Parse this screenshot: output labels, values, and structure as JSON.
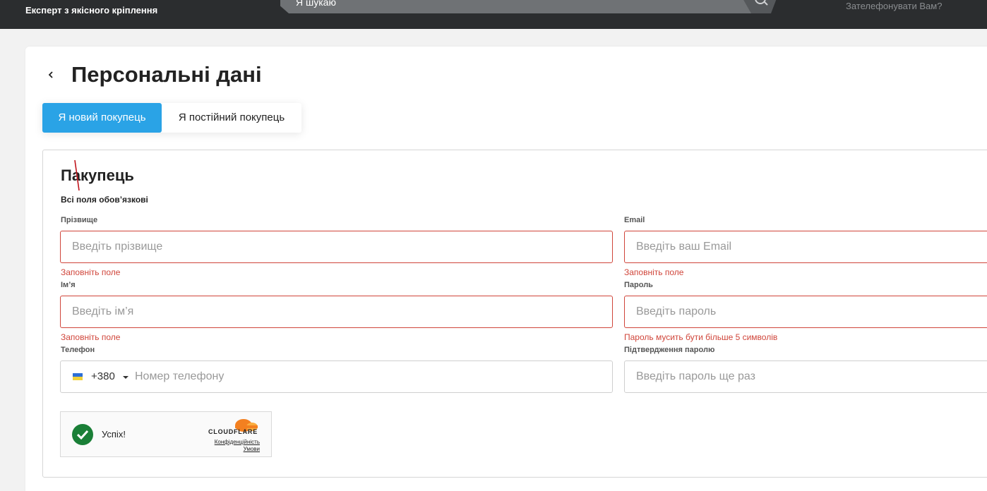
{
  "header": {
    "tagline": "Експерт з якісного кріплення",
    "search_placeholder": "Я шукаю",
    "callback_link": "Зателефонувати Вам?"
  },
  "page": {
    "title": "Персональні дані"
  },
  "tabs": [
    {
      "label": "Я новий покупець",
      "active": true
    },
    {
      "label": "Я постійний покупець",
      "active": false
    }
  ],
  "form": {
    "section_title": "Пакупець",
    "required_note": "Всі поля обов’язкові",
    "surname": {
      "label": "Прізвище",
      "placeholder": "Введіть прізвище",
      "error": "Заповніть поле"
    },
    "email": {
      "label": "Email",
      "placeholder": "Введіть ваш Email",
      "error": "Заповніть поле"
    },
    "name": {
      "label": "Ім’я",
      "placeholder": "Введіть ім’я",
      "error": "Заповніть поле"
    },
    "password": {
      "label": "Пароль",
      "placeholder": "Введіть пароль",
      "error": "Пароль мусить бути більше 5 символів"
    },
    "phone": {
      "label": "Телефон",
      "dial_code": "+380",
      "placeholder": "Номер телефону"
    },
    "password_confirm": {
      "label": "Підтвердження паролю",
      "placeholder": "Введіть пароль ще раз"
    }
  },
  "captcha": {
    "status": "Успіх!",
    "brand": "CLOUDFLARE",
    "privacy_link": "Конфіденційність",
    "terms_link": "Умови"
  },
  "colors": {
    "accent": "#2aa3e6",
    "error": "#d0453a",
    "header_bg": "#2b2d2f",
    "success": "#1a7f37",
    "cloudflare_orange": "#f38020"
  }
}
